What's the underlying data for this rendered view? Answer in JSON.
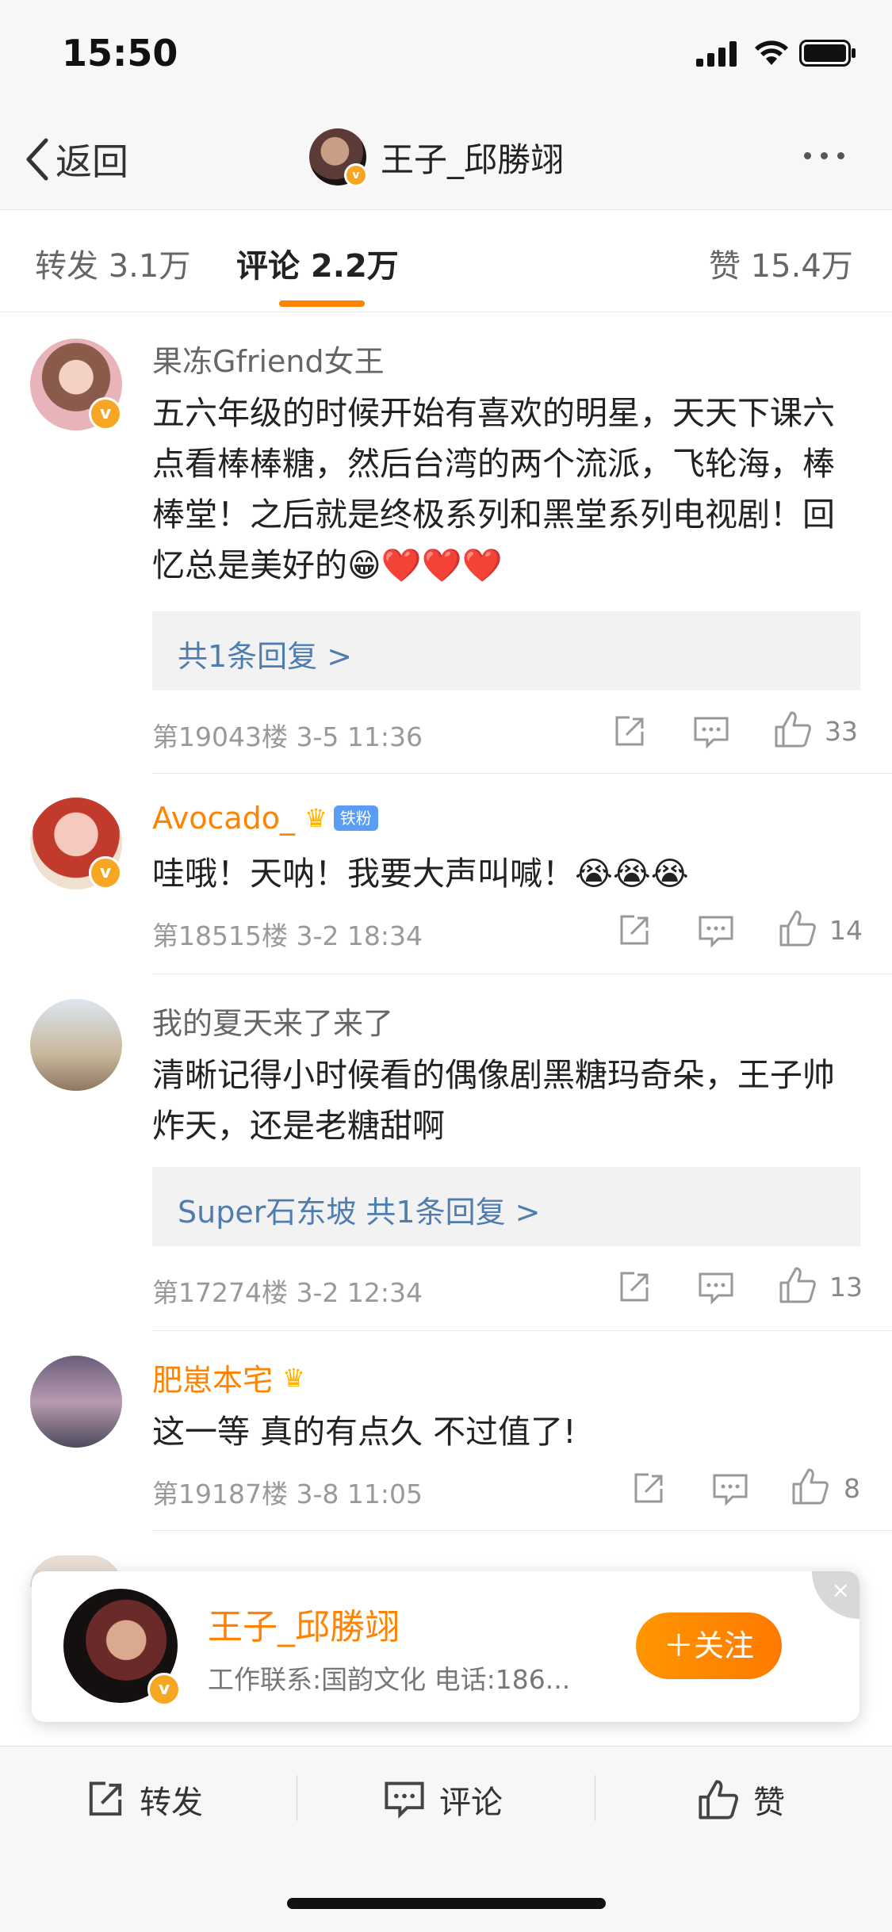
{
  "status": {
    "time": "15:50"
  },
  "nav": {
    "back_label": "返回",
    "title": "王子_邱勝翊"
  },
  "tabs": [
    {
      "label": "转发 3.1万"
    },
    {
      "label": "评论 2.2万"
    },
    {
      "label": "赞 15.4万"
    }
  ],
  "comments": [
    {
      "username": "果冻Gfriend女王",
      "text": "五六年级的时候开始有喜欢的明星，天天下课六点看棒棒糖，然后台湾的两个流派，飞轮海，棒棒堂！之后就是终极系列和黑堂系列电视剧！回忆总是美好的😁❤️❤️❤️",
      "reply": "共1条回复 >",
      "meta": "第19043楼 3-5 11:36",
      "likes": "33"
    },
    {
      "username": "Avocado_",
      "badge": "铁粉",
      "text": "哇哦！天呐！我要大声叫喊！😭😭😭",
      "meta": "第18515楼 3-2 18:34",
      "likes": "14"
    },
    {
      "username": "我的夏天来了来了",
      "text": "清晰记得小时候看的偶像剧黑糖玛奇朵，王子帅炸天，还是老糖甜啊",
      "reply": "Super石东坡  共1条回复 >",
      "meta": "第17274楼 3-2 12:34",
      "likes": "13"
    },
    {
      "username": "肥崽本宅",
      "text": "这一等 真的有点久 不过值了!",
      "meta": "第19187楼 3-8 11:05",
      "likes": "8"
    }
  ],
  "popup": {
    "name": "王子_邱勝翊",
    "subtitle": "工作联系:国韵文化 电话:186...",
    "follow_label": "＋关注",
    "close_icon": "×"
  },
  "bottom_bar": {
    "repost_label": "转发",
    "comment_label": "评论",
    "like_label": "赞"
  },
  "colors": {
    "accent": "#ff8200",
    "link": "#507daf",
    "badge_blue": "#5b9df5"
  }
}
